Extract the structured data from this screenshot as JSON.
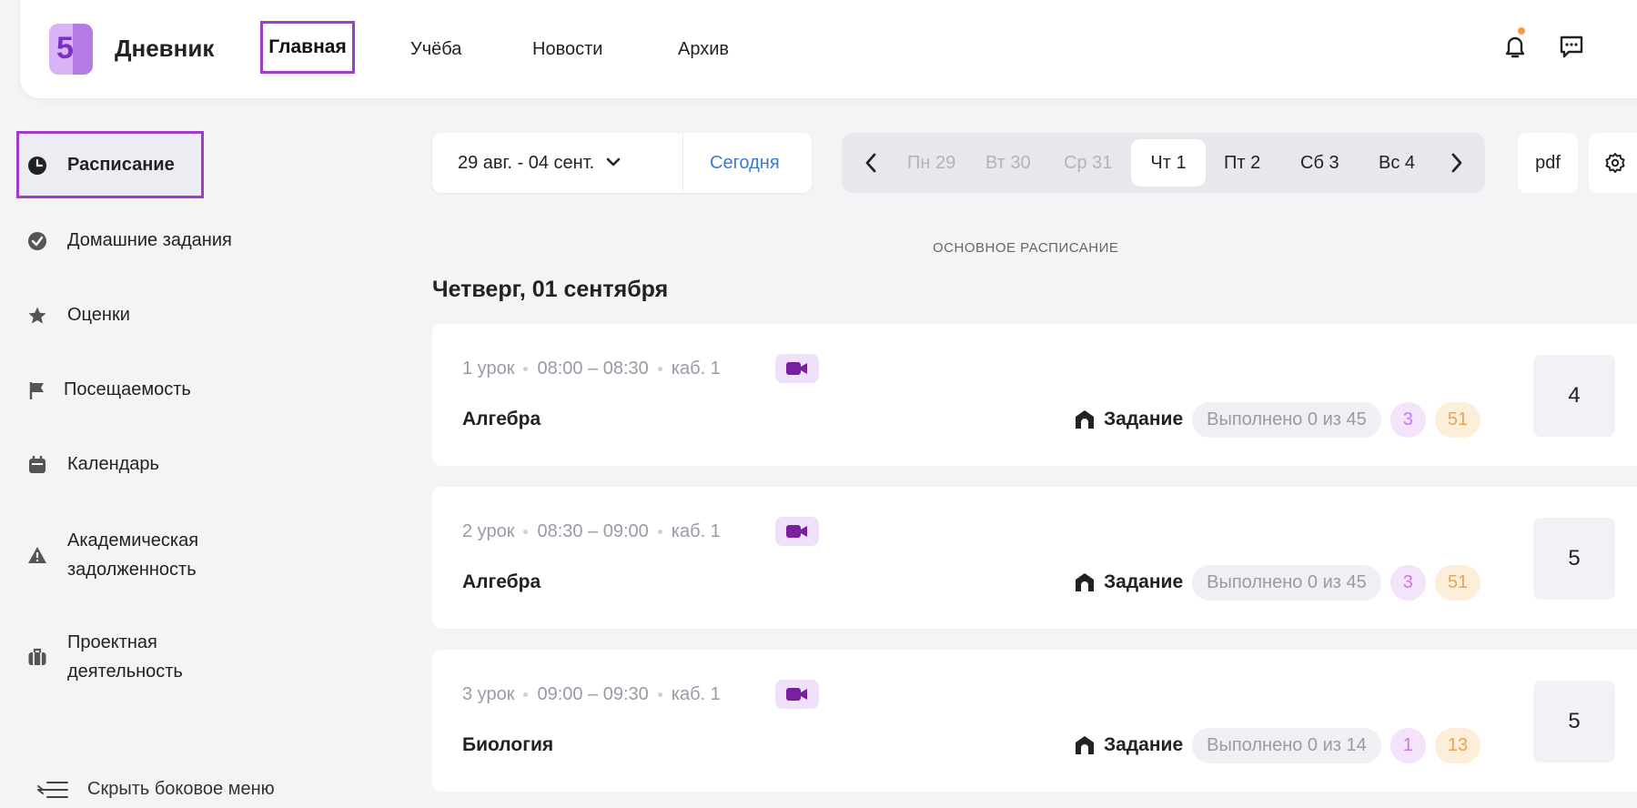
{
  "app": {
    "logo_digit": "5",
    "brand": "Дневник"
  },
  "topnav": {
    "items": [
      {
        "label": "Главная",
        "active": true
      },
      {
        "label": "Учёба"
      },
      {
        "label": "Новости"
      },
      {
        "label": "Архив"
      }
    ]
  },
  "colors": {
    "accent": "#a13cc9",
    "link": "#3a7bd5",
    "notification_dot": "#f2994a"
  },
  "sidebar": {
    "items": [
      {
        "label": "Расписание",
        "icon": "clock-icon",
        "active": true
      },
      {
        "label": "Домашние задания",
        "icon": "check-circle-icon"
      },
      {
        "label": "Оценки",
        "icon": "star-icon"
      },
      {
        "label": "Посещаемость",
        "icon": "flag-icon"
      },
      {
        "label": "Календарь",
        "icon": "calendar-icon"
      },
      {
        "label_line1": "Академическая",
        "label_line2": "задолженность",
        "icon": "warning-icon"
      },
      {
        "label_line1": "Проектная",
        "label_line2": "деятельность",
        "icon": "briefcase-icon"
      }
    ],
    "hide_label": "Скрыть боковое меню"
  },
  "toolbar": {
    "date_range": "29 авг. - 04 сент.",
    "today": "Сегодня",
    "days": [
      {
        "label": "Пн 29",
        "state": "dim"
      },
      {
        "label": "Вт 30",
        "state": "dim"
      },
      {
        "label": "Ср 31",
        "state": "dim"
      },
      {
        "label": "Чт 1",
        "state": "selected"
      },
      {
        "label": "Пт 2",
        "state": "normal"
      },
      {
        "label": "Сб 3",
        "state": "normal"
      },
      {
        "label": "Вс 4",
        "state": "normal"
      }
    ],
    "pdf": "pdf"
  },
  "schedule": {
    "section_label": "ОСНОВНОЕ РАСПИСАНИЕ",
    "day_title": "Четверг, 01 сентября",
    "lessons": [
      {
        "lesson": "1 урок",
        "time": "08:00 – 08:30",
        "room": "каб. 1",
        "subject": "Алгебра",
        "task_label": "Задание",
        "done": "Выполнено 0 из 45",
        "count_a": "3",
        "count_b": "51",
        "grade": "4"
      },
      {
        "lesson": "2 урок",
        "time": "08:30 – 09:00",
        "room": "каб. 1",
        "subject": "Алгебра",
        "task_label": "Задание",
        "done": "Выполнено 0 из 45",
        "count_a": "3",
        "count_b": "51",
        "grade": "5"
      },
      {
        "lesson": "3 урок",
        "time": "09:00 – 09:30",
        "room": "каб. 1",
        "subject": "Биология",
        "task_label": "Задание",
        "done": "Выполнено 0 из 14",
        "count_a": "1",
        "count_b": "13",
        "grade": "5"
      }
    ]
  }
}
